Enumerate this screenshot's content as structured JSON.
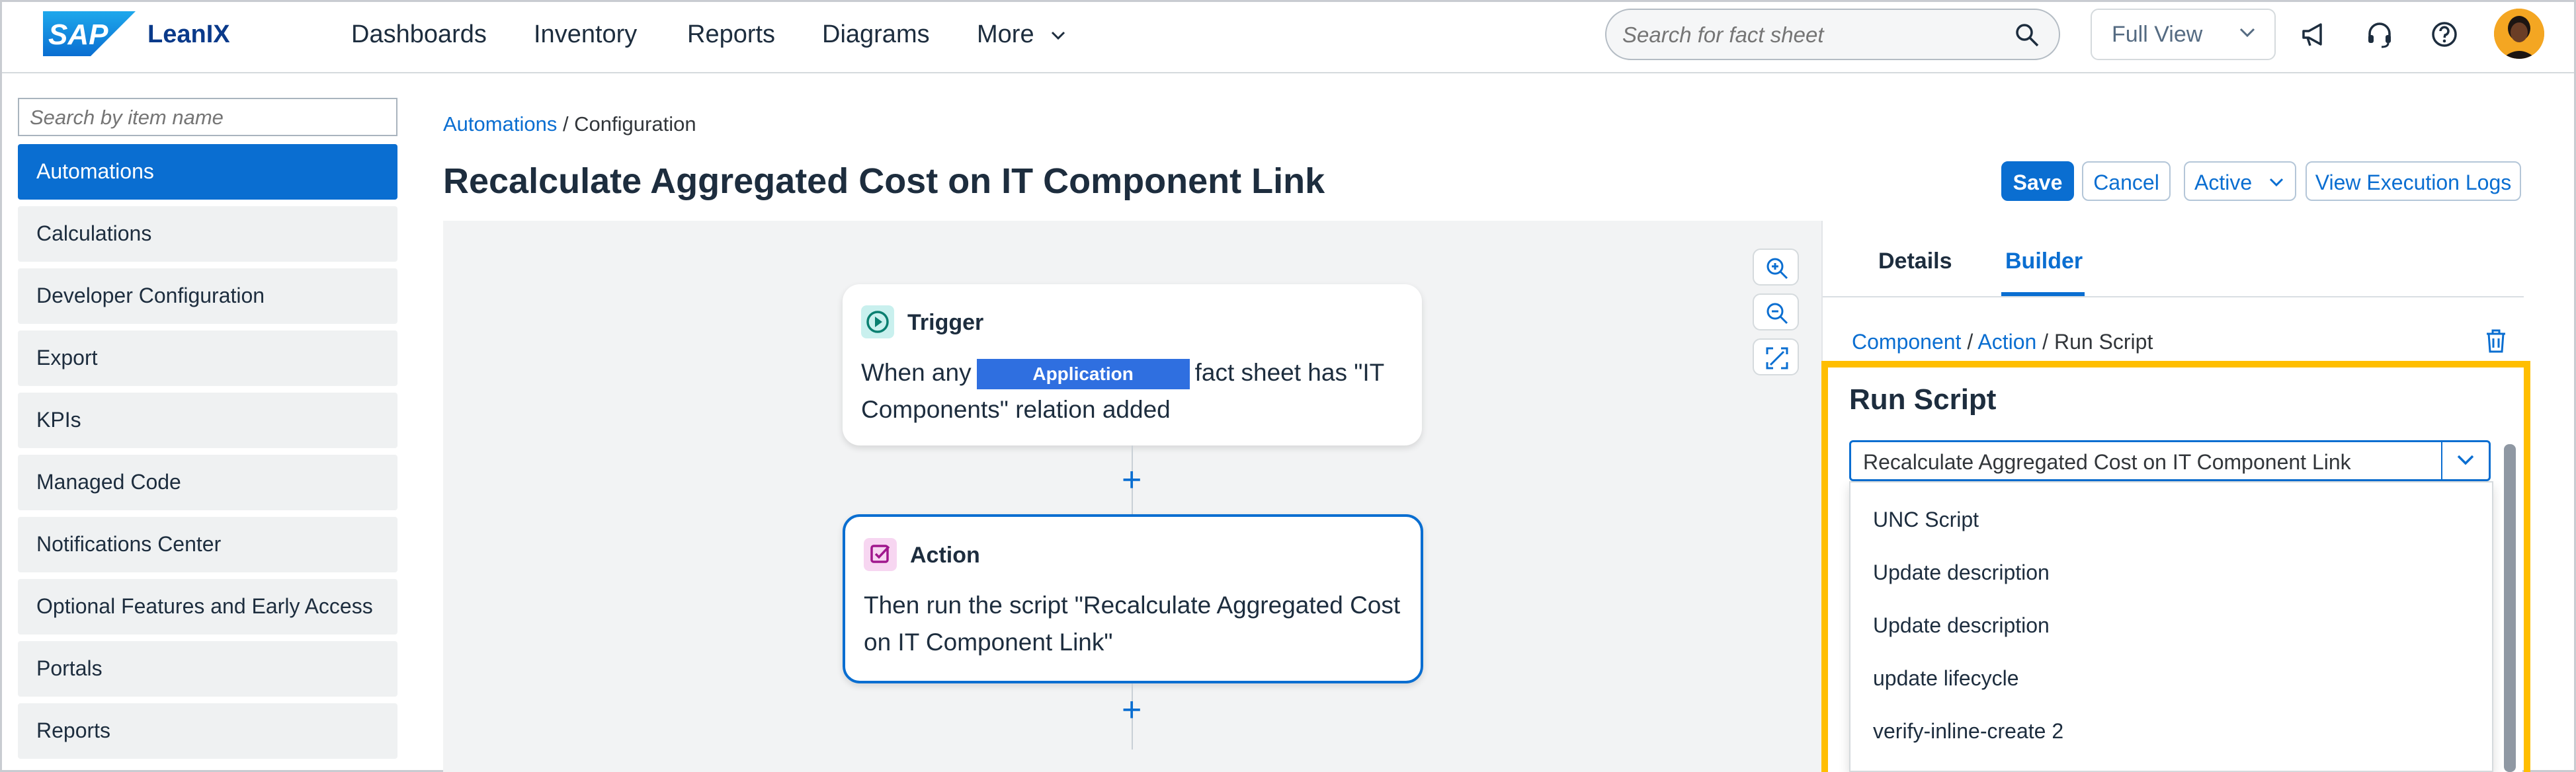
{
  "header": {
    "logo_text": "SAP",
    "brand": "LeanIX",
    "nav": [
      "Dashboards",
      "Inventory",
      "Reports",
      "Diagrams",
      "More"
    ],
    "search_placeholder": "Search for fact sheet",
    "view_select": "Full View",
    "icons": [
      "search-icon",
      "chevron-down-icon",
      "megaphone-icon",
      "headset-icon",
      "help-icon",
      "avatar"
    ]
  },
  "sidebar": {
    "search_placeholder": "Search by item name",
    "items": [
      {
        "label": "Automations",
        "active": true
      },
      {
        "label": "Calculations"
      },
      {
        "label": "Developer Configuration"
      },
      {
        "label": "Export"
      },
      {
        "label": "KPIs"
      },
      {
        "label": "Managed Code"
      },
      {
        "label": "Notifications Center"
      },
      {
        "label": "Optional Features and Early Access"
      },
      {
        "label": "Portals"
      },
      {
        "label": "Reports"
      }
    ]
  },
  "main": {
    "breadcrumb": {
      "link": "Automations",
      "separator": " / ",
      "current": "Configuration"
    },
    "title": "Recalculate Aggregated Cost on IT Component Link",
    "actions": {
      "save": "Save",
      "cancel": "Cancel",
      "status": "Active",
      "logs": "View Execution Logs"
    }
  },
  "canvas": {
    "trigger": {
      "title": "Trigger",
      "text_before": "When any",
      "chip": "Application",
      "text_after": "fact sheet has \"IT",
      "text_line2": "Components\" relation added"
    },
    "action": {
      "title": "Action",
      "text_line1": "Then run the script \"Recalculate Aggregated Cost",
      "text_line2": "on IT Component Link\""
    },
    "add_symbol": "+"
  },
  "panel": {
    "tabs": [
      "Details",
      "Builder"
    ],
    "active_tab": "Builder",
    "breadcrumb": {
      "component": "Component",
      "action": "Action",
      "current": "Run Script"
    },
    "section_title": "Run Script",
    "selected_script": "Recalculate Aggregated Cost on IT Component Link",
    "options": [
      "UNC Script",
      "Update description",
      "Update description",
      "update lifecycle",
      "verify-inline-create 2"
    ]
  },
  "colors": {
    "accent": "#0a6ed1",
    "highlight": "#ffbe00",
    "chip": "#2f6fe0"
  }
}
